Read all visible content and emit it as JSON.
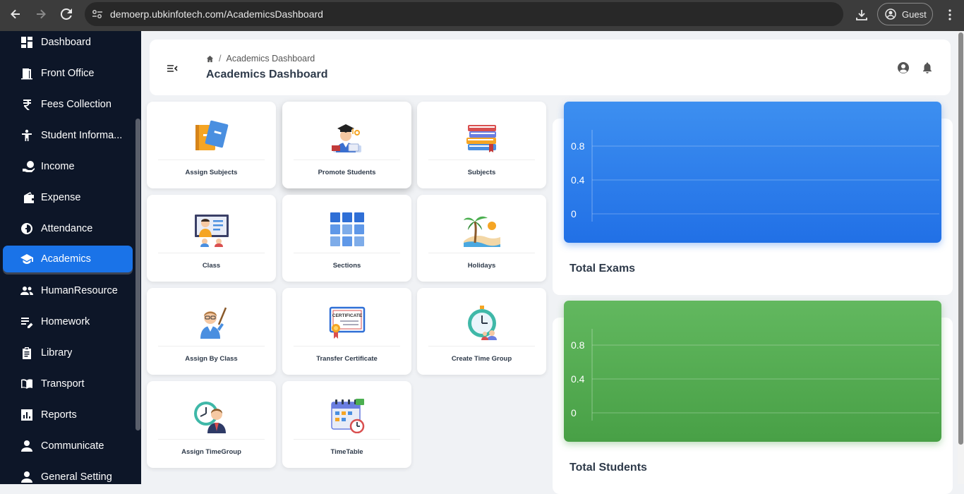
{
  "browser": {
    "url": "demoerp.ubkinfotech.com/AcademicsDashboard",
    "profile_label": "Guest"
  },
  "sidebar": {
    "items": [
      {
        "label": "Dashboard",
        "icon": "dashboard-icon"
      },
      {
        "label": "Front Office",
        "icon": "door-icon"
      },
      {
        "label": "Fees Collection",
        "icon": "rupee-icon"
      },
      {
        "label": "Student Informa...",
        "icon": "student-icon"
      },
      {
        "label": "Income",
        "icon": "income-icon"
      },
      {
        "label": "Expense",
        "icon": "wallet-icon"
      },
      {
        "label": "Attendance",
        "icon": "attendance-icon"
      },
      {
        "label": "Academics",
        "icon": "graduation-cap-icon",
        "active": true
      },
      {
        "label": "HumanResource",
        "icon": "people-icon"
      },
      {
        "label": "Homework",
        "icon": "edit-list-icon"
      },
      {
        "label": "Library",
        "icon": "clipboard-icon"
      },
      {
        "label": "Transport",
        "icon": "book-open-icon"
      },
      {
        "label": "Reports",
        "icon": "bar-chart-icon"
      },
      {
        "label": "Communicate",
        "icon": "person-icon"
      },
      {
        "label": "General Setting",
        "icon": "person-gear-icon"
      }
    ]
  },
  "header": {
    "breadcrumb": "Academics Dashboard",
    "title": "Academics Dashboard"
  },
  "tiles": [
    {
      "label": "Assign Subjects",
      "icon": "folders-icon"
    },
    {
      "label": "Promote Students",
      "icon": "graduate-icon"
    },
    {
      "label": "Subjects",
      "icon": "books-icon"
    },
    {
      "label": "Class",
      "icon": "teacher-board-icon"
    },
    {
      "label": "Sections",
      "icon": "grid-icon"
    },
    {
      "label": "Holidays",
      "icon": "beach-icon"
    },
    {
      "label": "Assign By Class",
      "icon": "teacher-icon"
    },
    {
      "label": "Transfer Certificate",
      "icon": "certificate-icon"
    },
    {
      "label": "Create Time Group",
      "icon": "clock-group-icon"
    },
    {
      "label": "Assign TimeGroup",
      "icon": "clock-person-icon"
    },
    {
      "label": "TimeTable",
      "icon": "calendar-icon"
    }
  ],
  "certificate_text": "CERTIFICATE",
  "stats": {
    "exams_title": "Total Exams",
    "students_title": "Total Students"
  },
  "chart_data": [
    {
      "type": "line",
      "title": "Total Exams",
      "y_ticks": [
        0.8,
        0.4,
        0
      ],
      "series": [],
      "grid": true
    },
    {
      "type": "line",
      "title": "Total Students",
      "y_ticks": [
        0.8,
        0.4,
        0
      ],
      "series": [],
      "grid": true
    }
  ],
  "colors": {
    "sidebar_bg": "#0d1628",
    "accent": "#1a73e8",
    "exams_chart": "#2170e6",
    "students_chart": "#48a046"
  }
}
